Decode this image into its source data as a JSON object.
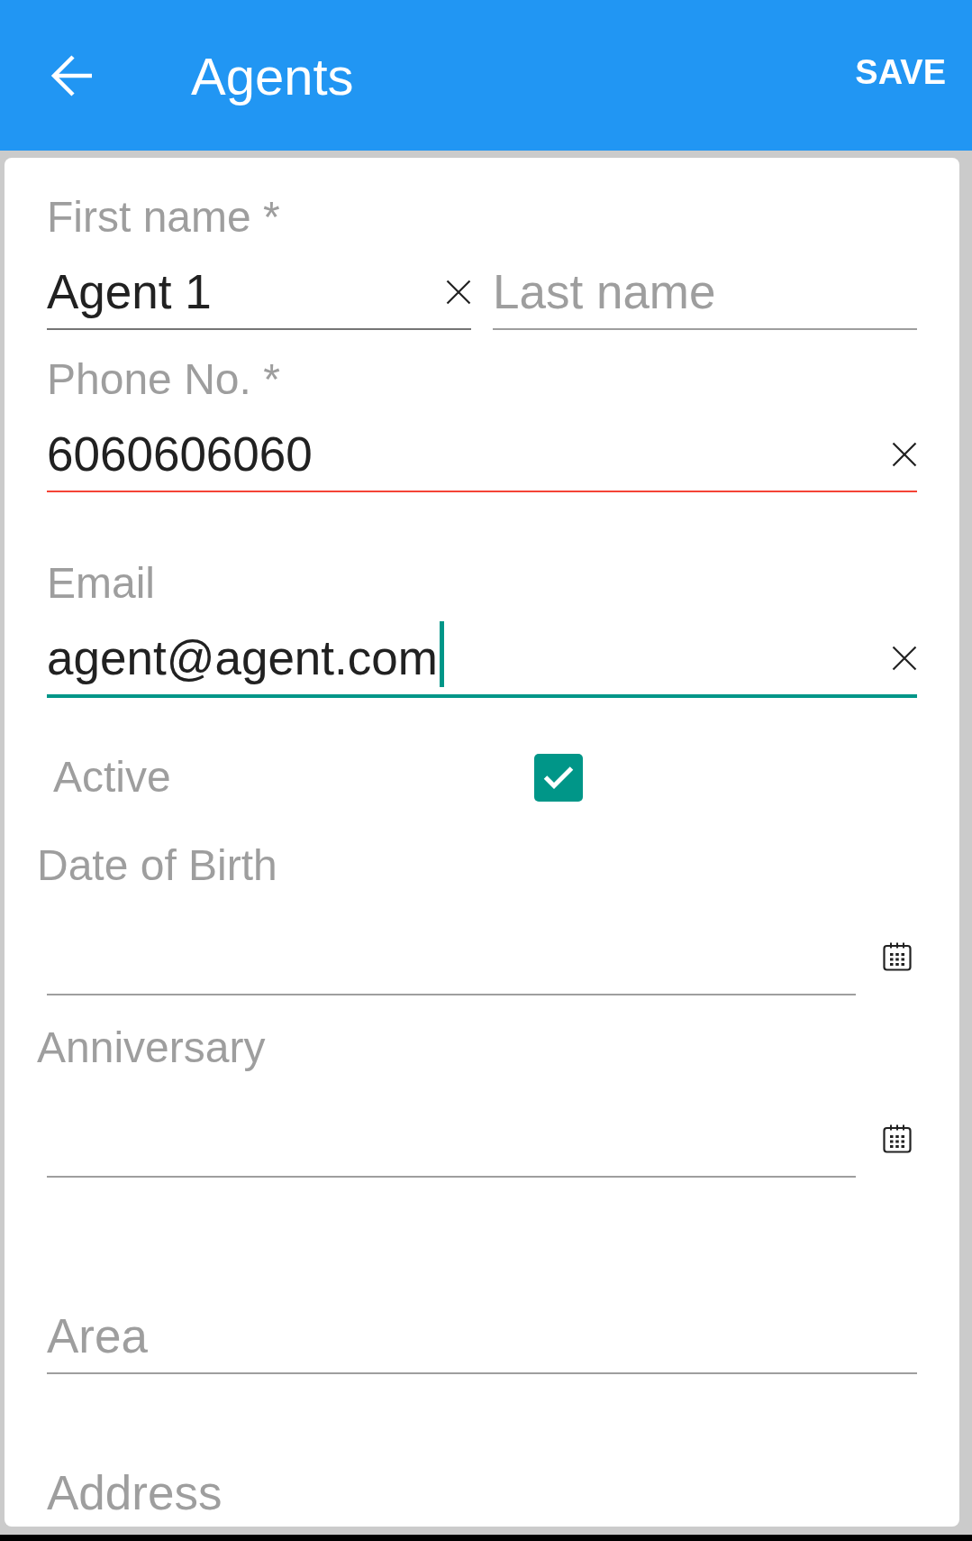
{
  "app_bar": {
    "title": "Agents",
    "action": "SAVE"
  },
  "form": {
    "rows": [
      {
        "kind": "pair",
        "fields": [
          {
            "label": "First name *",
            "value": "Agent 1",
            "clear_button": true,
            "focused": false,
            "error": false
          },
          {
            "placeholder": "Last name",
            "clear_button": false,
            "focused": false,
            "error": false
          }
        ]
      },
      {
        "kind": "text",
        "label": "Phone No. *",
        "value": "6060606060",
        "clear_button": true,
        "focused": false,
        "error": true
      },
      {
        "kind": "text",
        "label": "Email",
        "value": "agent@agent.com",
        "clear_button": true,
        "focused": true,
        "error": false
      },
      {
        "kind": "checkbox",
        "label": "Active",
        "checked": true
      },
      {
        "kind": "date",
        "label": "Date of Birth"
      },
      {
        "kind": "date",
        "label": "Anniversary"
      },
      {
        "kind": "text",
        "placeholder": "Area",
        "clear_button": false,
        "focused": false,
        "error": false
      },
      {
        "kind": "text",
        "placeholder": "Address",
        "clear_button": false,
        "focused": false,
        "error": false
      }
    ]
  }
}
